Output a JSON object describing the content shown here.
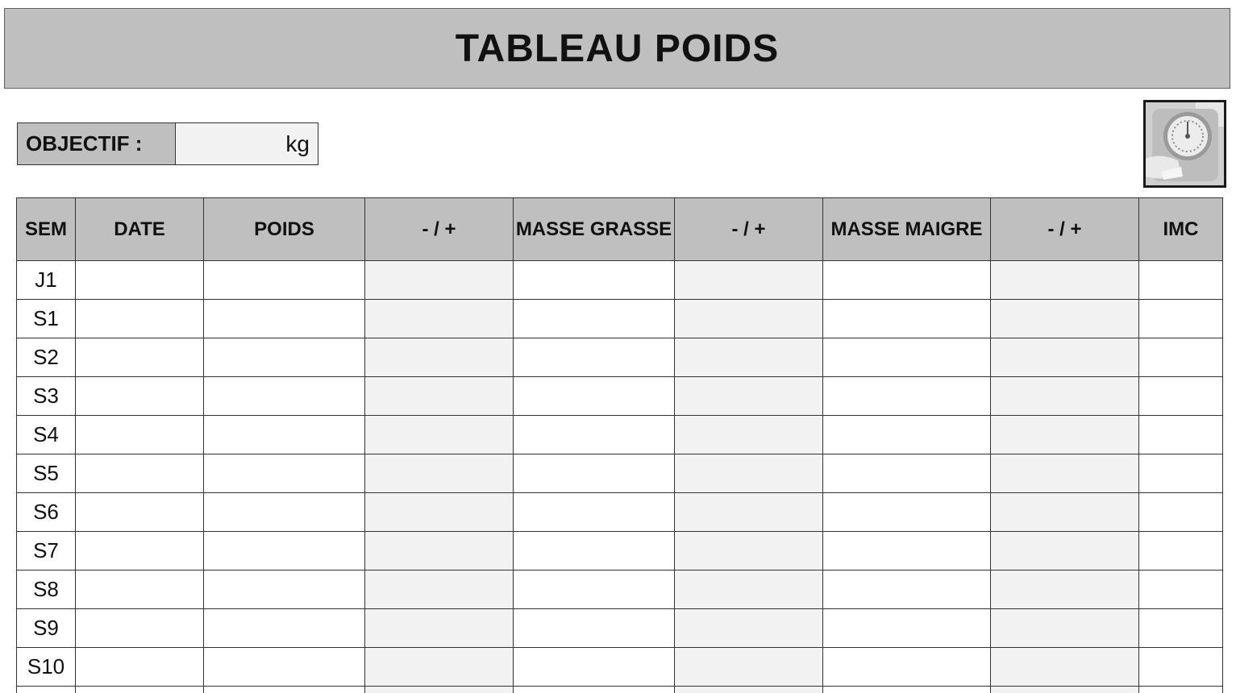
{
  "title": "TABLEAU POIDS",
  "objective": {
    "label": "OBJECTIF :",
    "value": "",
    "unit": "kg"
  },
  "image": {
    "icon": "bathroom-scale-photo"
  },
  "colors": {
    "header_bg": "#bfbfbf",
    "shaded_column_bg": "#f2f2f2",
    "border": "#333333"
  },
  "table": {
    "headers": [
      "SEM",
      "DATE",
      "POIDS",
      "- / +",
      "MASSE GRASSE",
      "- / +",
      "MASSE MAIGRE",
      "- / +",
      "IMC"
    ],
    "rows": [
      {
        "sem": "J1",
        "date": "",
        "poids": "",
        "diff1": "",
        "masse_grasse": "",
        "diff2": "",
        "masse_maigre": "",
        "diff3": "",
        "imc": ""
      },
      {
        "sem": "S1",
        "date": "",
        "poids": "",
        "diff1": "",
        "masse_grasse": "",
        "diff2": "",
        "masse_maigre": "",
        "diff3": "",
        "imc": ""
      },
      {
        "sem": "S2",
        "date": "",
        "poids": "",
        "diff1": "",
        "masse_grasse": "",
        "diff2": "",
        "masse_maigre": "",
        "diff3": "",
        "imc": ""
      },
      {
        "sem": "S3",
        "date": "",
        "poids": "",
        "diff1": "",
        "masse_grasse": "",
        "diff2": "",
        "masse_maigre": "",
        "diff3": "",
        "imc": ""
      },
      {
        "sem": "S4",
        "date": "",
        "poids": "",
        "diff1": "",
        "masse_grasse": "",
        "diff2": "",
        "masse_maigre": "",
        "diff3": "",
        "imc": ""
      },
      {
        "sem": "S5",
        "date": "",
        "poids": "",
        "diff1": "",
        "masse_grasse": "",
        "diff2": "",
        "masse_maigre": "",
        "diff3": "",
        "imc": ""
      },
      {
        "sem": "S6",
        "date": "",
        "poids": "",
        "diff1": "",
        "masse_grasse": "",
        "diff2": "",
        "masse_maigre": "",
        "diff3": "",
        "imc": ""
      },
      {
        "sem": "S7",
        "date": "",
        "poids": "",
        "diff1": "",
        "masse_grasse": "",
        "diff2": "",
        "masse_maigre": "",
        "diff3": "",
        "imc": ""
      },
      {
        "sem": "S8",
        "date": "",
        "poids": "",
        "diff1": "",
        "masse_grasse": "",
        "diff2": "",
        "masse_maigre": "",
        "diff3": "",
        "imc": ""
      },
      {
        "sem": "S9",
        "date": "",
        "poids": "",
        "diff1": "",
        "masse_grasse": "",
        "diff2": "",
        "masse_maigre": "",
        "diff3": "",
        "imc": ""
      },
      {
        "sem": "S10",
        "date": "",
        "poids": "",
        "diff1": "",
        "masse_grasse": "",
        "diff2": "",
        "masse_maigre": "",
        "diff3": "",
        "imc": ""
      }
    ]
  }
}
